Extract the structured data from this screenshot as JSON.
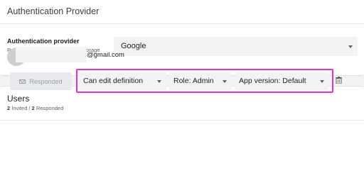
{
  "auth_section": {
    "title": "Authentication Provider",
    "field_label": "Authentication provider",
    "field_description": "Provider for user signin and file storage",
    "selected_provider": "Google"
  },
  "users_section": {
    "title": "Users",
    "invited_count": "2",
    "invited_label": "Invited /",
    "responded_count": "2",
    "responded_label": "Responded",
    "user": {
      "email_domain": "@gmail.com",
      "status_button": "Responded",
      "permission": "Can edit definition",
      "role": "Role: Admin",
      "app_version": "App version: Default"
    }
  },
  "colors": {
    "highlight": "#ee2bd6",
    "field_background": "#f1f3f4"
  },
  "icons": {
    "dropdown": "caret-down-icon",
    "status": "envelope-icon",
    "delete": "trash-icon"
  }
}
